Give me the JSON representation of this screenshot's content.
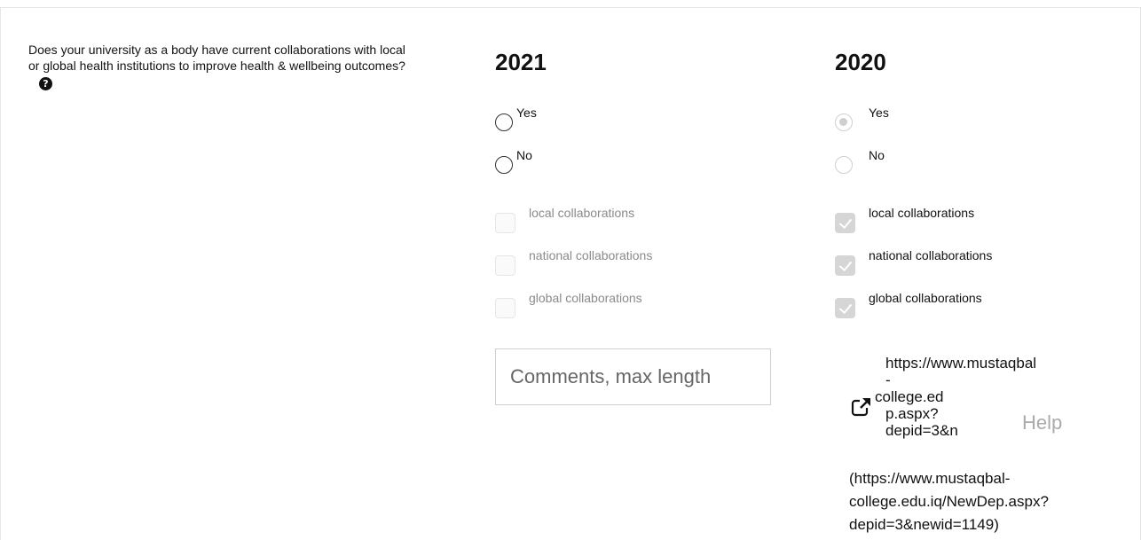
{
  "question": {
    "text": "Does your university as a body have current collaborations with local or global health institutions to improve health & wellbeing outcomes?",
    "help_icon": "question-circle-icon",
    "help_glyph": "?"
  },
  "years": [
    {
      "year": "2021",
      "radios": [
        {
          "label": "Yes",
          "checked": false,
          "disabled": false
        },
        {
          "label": "No",
          "checked": false,
          "disabled": false
        }
      ],
      "checkboxes": [
        {
          "label": "local collaborations",
          "checked": false,
          "disabled": true
        },
        {
          "label": "national collaborations",
          "checked": false,
          "disabled": true
        },
        {
          "label": "global collaborations",
          "checked": false,
          "disabled": true
        }
      ],
      "comments_placeholder": "Comments, max length"
    },
    {
      "year": "2020",
      "radios": [
        {
          "label": "Yes",
          "checked": true,
          "disabled": true
        },
        {
          "label": "No",
          "checked": false,
          "disabled": true
        }
      ],
      "checkboxes": [
        {
          "label": "local collaborations",
          "checked": true,
          "disabled": true
        },
        {
          "label": "national collaborations",
          "checked": true,
          "disabled": true
        },
        {
          "label": "global collaborations",
          "checked": true,
          "disabled": true
        }
      ],
      "link": {
        "line1": "https://www.mustaqbal",
        "line2": "-",
        "line3": "college.ed",
        "line4": "p.aspx?",
        "line5": "depid=3&n",
        "icon": "external-link-icon",
        "help_label": "Help",
        "full_url_1": "(https://www.mustaqbal-",
        "full_url_2": "college.edu.iq/NewDep.aspx?",
        "full_url_3": "depid=3&newid=1149)"
      }
    }
  ],
  "colors": {
    "checked_disabled": "#d6d6d6",
    "muted_text": "#8a8a8a",
    "border": "#e6e6e6"
  }
}
